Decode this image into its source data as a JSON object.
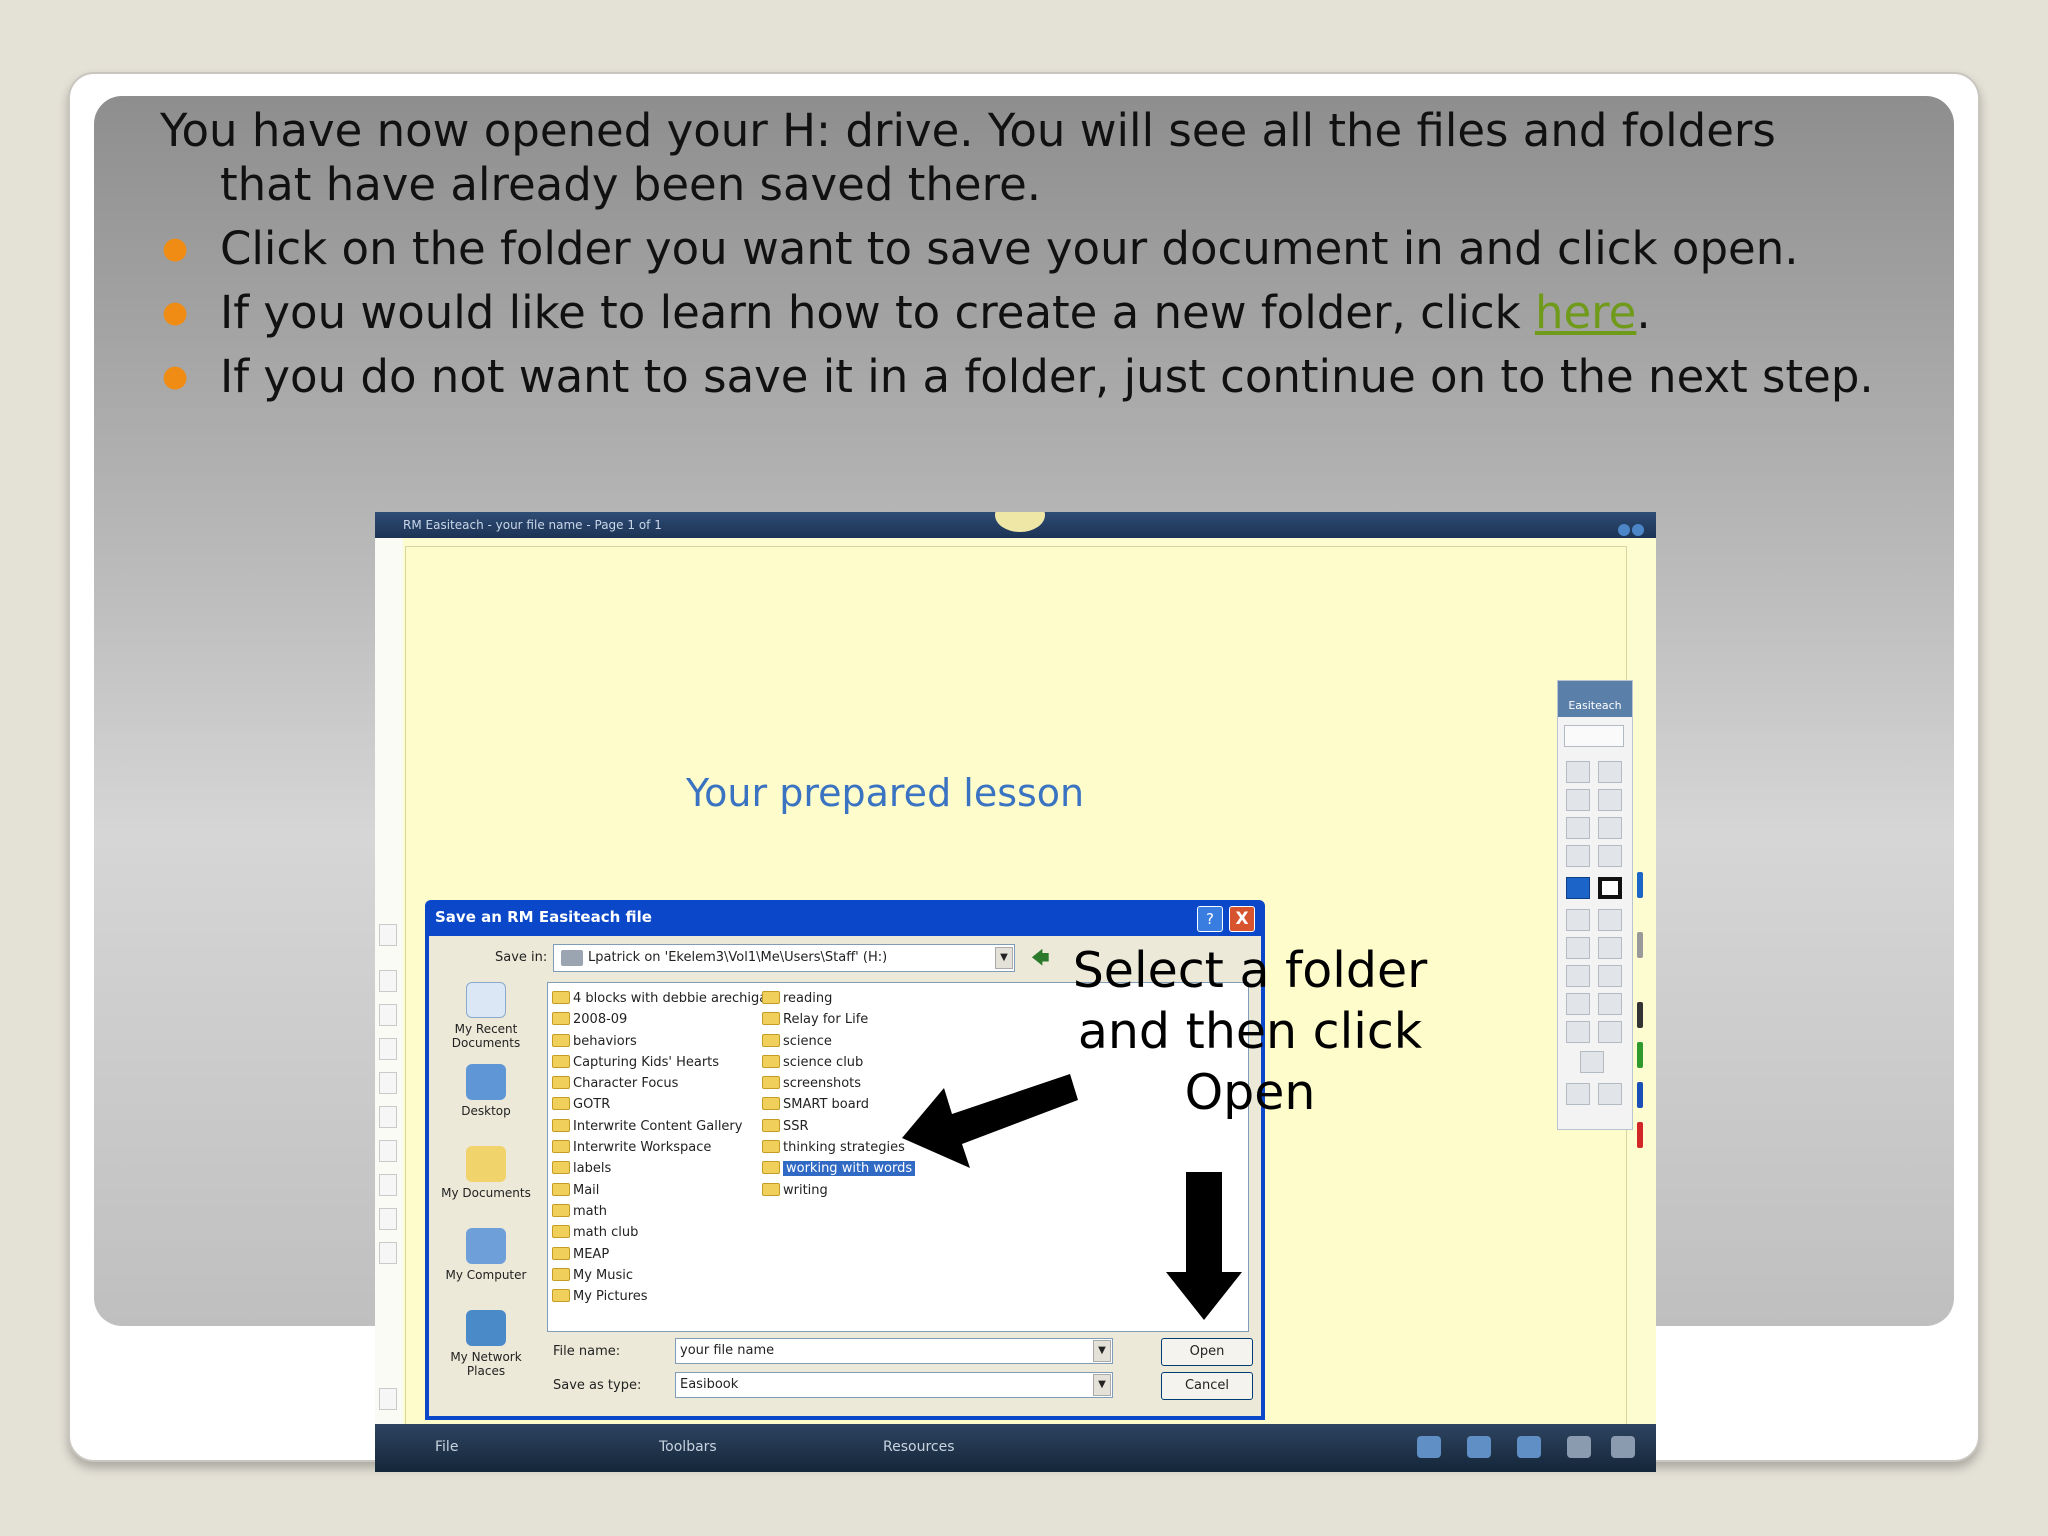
{
  "slide": {
    "intro": "You have now opened your H: drive.  You will see all the files and folders that have already been saved there.",
    "bullets": [
      {
        "text": "Click on the folder you want to save your document in and click open."
      },
      {
        "text_before": "If you would like to learn how to create a new folder, click ",
        "link": "here",
        "text_after": "."
      },
      {
        "text": "If you do not want to save it in a folder, just continue on to the next step."
      }
    ],
    "annotation": "Select a folder and then click Open"
  },
  "app": {
    "title": "RM Easiteach - your file name - Page 1 of 1",
    "lesson_text": "Your prepared lesson",
    "toolbox_title": "Easiteach",
    "taskbar": {
      "file": "File",
      "toolbars": "Toolbars",
      "resources": "Resources"
    }
  },
  "dialog": {
    "title": "Save an RM Easiteach file",
    "help_label": "?",
    "close_label": "X",
    "save_in_label": "Save in:",
    "save_in_value": "Lpatrick on 'Ekelem3\\Vol1\\Me\\Users\\Staff' (H:)",
    "places": [
      "My Recent Documents",
      "Desktop",
      "My Documents",
      "My Computer",
      "My Network Places"
    ],
    "folders_col1": [
      "4 blocks with debbie arechiga",
      "2008-09",
      "behaviors",
      "Capturing Kids' Hearts",
      "Character Focus",
      "GOTR",
      "Interwrite Content Gallery",
      "Interwrite Workspace",
      "labels",
      "Mail",
      "math",
      "math club",
      "MEAP",
      "My Music",
      "My Pictures"
    ],
    "folders_col2": [
      "reading",
      "Relay for Life",
      "science",
      "science club",
      "screenshots",
      "SMART board",
      "SSR",
      "thinking strategies",
      "working with words",
      "writing"
    ],
    "selected_folder": "working with words",
    "file_name_label": "File name:",
    "file_name_value": "your file name",
    "save_type_label": "Save as type:",
    "save_type_value": "Easibook",
    "open_button": "Open",
    "cancel_button": "Cancel"
  },
  "colors": {
    "bullet": "#f08c14",
    "link": "#6f9a1a",
    "lesson": "#3a73c2",
    "dialog": "#0a47c9",
    "selection": "#316ac5"
  }
}
